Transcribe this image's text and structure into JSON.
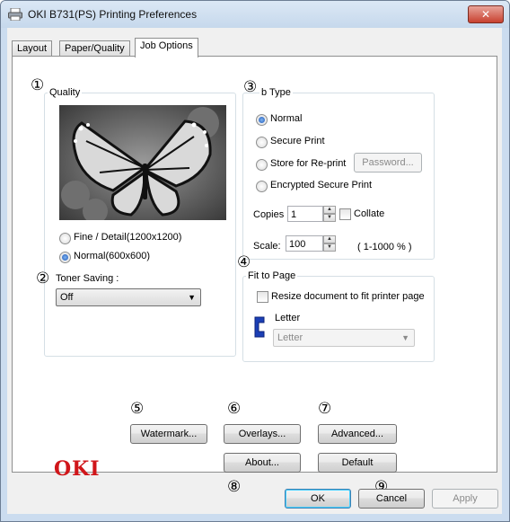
{
  "window": {
    "title": "OKI B731(PS) Printing Preferences",
    "close_glyph": "✕"
  },
  "tabs": [
    {
      "label": "Layout"
    },
    {
      "label": "Paper/Quality"
    },
    {
      "label": "Job Options"
    }
  ],
  "markers": [
    "①",
    "②",
    "③",
    "④",
    "⑤",
    "⑥",
    "⑦",
    "⑧",
    "⑨"
  ],
  "quality": {
    "title": "Quality",
    "options": [
      {
        "label": "Fine / Detail(1200x1200)",
        "selected": false
      },
      {
        "label": "Normal(600x600)",
        "selected": true
      }
    ]
  },
  "toner_saving": {
    "label": "Toner Saving :",
    "value": "Off"
  },
  "job_type": {
    "title": "b Type",
    "options": [
      {
        "label": "Normal",
        "selected": true
      },
      {
        "label": "Secure Print",
        "selected": false
      },
      {
        "label": "Store for Re-print",
        "selected": false
      },
      {
        "label": "Encrypted Secure Print",
        "selected": false
      }
    ],
    "password_button": "Password...",
    "copies_label": "Copies",
    "copies_value": "1",
    "collate_label": "Collate",
    "collate_checked": false,
    "scale_label": "Scale:",
    "scale_value": "100",
    "scale_range": "( 1-1000 % )"
  },
  "fit_to_page": {
    "title": "Fit to Page",
    "resize_label": "Resize document to fit printer page",
    "resize_checked": false,
    "paper_label": "Letter",
    "paper_value": "Letter"
  },
  "buttons": {
    "watermark": "Watermark...",
    "overlays": "Overlays...",
    "advanced": "Advanced...",
    "about": "About...",
    "default": "Default",
    "ok": "OK",
    "cancel": "Cancel",
    "apply": "Apply"
  },
  "logo": "OKI",
  "colors": {
    "brand_red": "#d0161a",
    "selection_blue": "#1c57b8",
    "tab_border": "#8e8f8f"
  }
}
